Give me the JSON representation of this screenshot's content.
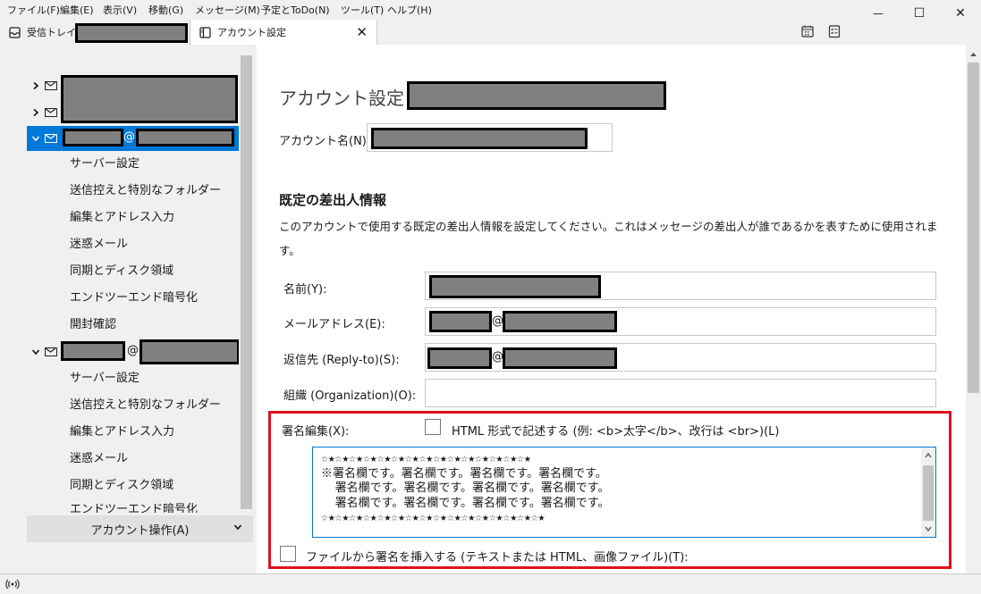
{
  "menubar": {
    "items": [
      "ファイル(F)",
      "編集(E)",
      "表示(V)",
      "移動(G)",
      "メッセージ(M)",
      "予定とToDo(N)",
      "ツール(T)",
      "ヘルプ(H)"
    ]
  },
  "window_controls": {
    "minimize": "—",
    "maximize": "☐",
    "close": "✕"
  },
  "tabs": {
    "inbox": {
      "label": "受信トレイ"
    },
    "account_settings": {
      "label": "アカウント設定",
      "close": "✕"
    }
  },
  "sidebar": {
    "account3_at": "@",
    "account4_at": "@",
    "sub_items_a": [
      "サーバー設定",
      "送信控えと特別なフォルダー",
      "編集とアドレス入力",
      "迷惑メール",
      "同期とディスク領域",
      "エンドツーエンド暗号化",
      "開封確認"
    ],
    "sub_items_b": [
      "サーバー設定",
      "送信控えと特別なフォルダー",
      "編集とアドレス入力",
      "迷惑メール",
      "同期とディスク領域",
      "エンドツーエンド暗号化"
    ],
    "account_actions": "アカウント操作(A)"
  },
  "main": {
    "title": "アカウント設定 -",
    "account_name_label": "アカウント名(N):",
    "section_heading": "既定の差出人情報",
    "section_desc_1": "このアカウントで使用する既定の差出人情報を設定してください。これはメッセージの差出人が誰であるかを表すために使用されま",
    "section_desc_2": "す。",
    "fields": {
      "name_label": "名前(Y):",
      "email_label": "メールアドレス(E):",
      "email_at": "@",
      "reply_to_label": "返信先 (Reply-to)(S):",
      "reply_to_at": "@",
      "org_label": "組織 (Organization)(O):"
    },
    "signature": {
      "label": "署名編集(X):",
      "html_checkbox_label": "HTML 形式で記述する (例: <b>太字</b>、改行は <br>)(L)",
      "html_checked": false,
      "lines": [
        "☆★☆★☆★☆★☆★☆★☆★☆★☆★☆★☆★☆★☆★☆★☆★",
        "※署名欄です。署名欄です。署名欄です。署名欄です。",
        "  署名欄です。署名欄です。署名欄です。署名欄です。",
        "  署名欄です。署名欄です。署名欄です。署名欄です。",
        "☆★☆★☆★☆★☆★☆★☆★☆★☆★☆★☆★☆★☆★☆★☆★☆★"
      ],
      "file_checkbox_label": "ファイルから署名を挿入する (テキストまたは HTML、画像ファイル)(T):",
      "file_checked": false
    }
  },
  "colors": {
    "selection": "#0078d7",
    "highlight_frame": "#e01020",
    "redaction": "#808080"
  },
  "icons": [
    "inbox-icon",
    "account-settings-icon",
    "calendar-icon",
    "tasks-icon",
    "mail-icon",
    "chevron-right-icon",
    "chevron-down-icon",
    "activity-icon"
  ]
}
